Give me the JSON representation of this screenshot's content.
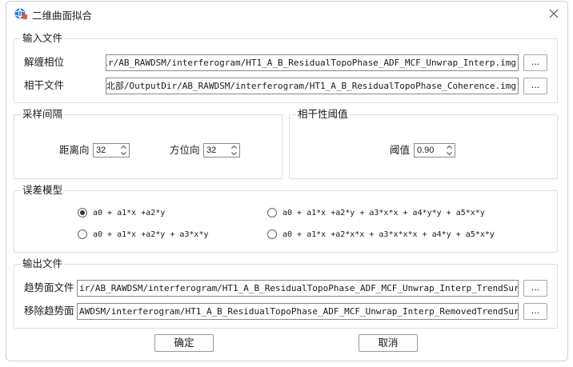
{
  "window": {
    "title": "二维曲面拟合"
  },
  "input_group": {
    "title": "输入文件",
    "unwrap": {
      "label": "解缠相位",
      "value": "OutputDir/AB_RAWDSM/interferogram/HT1_A_B_ResidualTopoPhase_ADF_MCF_Unwrap_Interp.img",
      "browse_label": "..."
    },
    "coherence": {
      "label": "相干文件",
      "value": "/朝鲜东北部/OutputDir/AB_RAWDSM/interferogram/HT1_A_B_ResidualTopoPhase_Coherence.img",
      "browse_label": "..."
    }
  },
  "sampling_group": {
    "title": "采样间隔",
    "range": {
      "label": "距离向",
      "value": "32"
    },
    "azimuth": {
      "label": "方位向",
      "value": "32"
    }
  },
  "coherence_group": {
    "title": "相干性阈值",
    "threshold": {
      "label": "阈值",
      "value": "0.90"
    }
  },
  "error_model_group": {
    "title": "误差模型",
    "options": [
      {
        "label": "a0 + a1*x +a2*y",
        "checked": true
      },
      {
        "label": "a0 + a1*x +a2*y + a3*x*x + a4*y*y + a5*x*y",
        "checked": false
      },
      {
        "label": "a0 + a1*x +a2*y + a3*x*y",
        "checked": false
      },
      {
        "label": "a0 + a1*x +a2*x*x + a3*x*x*x + a4*y + a5*x*y",
        "checked": false
      }
    ]
  },
  "output_group": {
    "title": "输出文件",
    "trend": {
      "label": "趋势面文件",
      "value": "ir/AB_RAWDSM/interferogram/HT1_A_B_ResidualTopoPhase_ADF_MCF_Unwrap_Interp_TrendSurface.img",
      "browse_label": "..."
    },
    "removed": {
      "label": "移除趋势面",
      "value": "AWDSM/interferogram/HT1_A_B_ResidualTopoPhase_ADF_MCF_Unwrap_Interp_RemovedTrendSurface.img",
      "browse_label": "..."
    }
  },
  "buttons": {
    "ok": "确定",
    "cancel": "取消"
  },
  "icons": {
    "app": "globe-app-icon",
    "close": "close-icon",
    "spin_up": "chevron-up-icon",
    "spin_down": "chevron-down-icon"
  }
}
